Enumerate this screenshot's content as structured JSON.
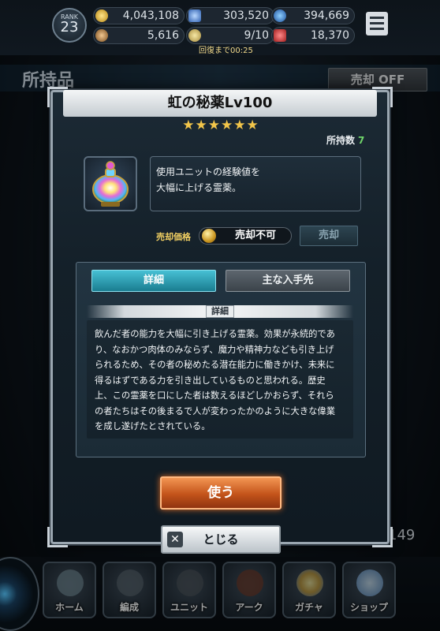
{
  "status": {
    "rank_label": "RANK",
    "rank_value": "23",
    "resources": [
      {
        "icon": "gold-coin-icon",
        "value": "4,043,108"
      },
      {
        "icon": "blue-gem-icon",
        "value": "303,520"
      },
      {
        "icon": "blue-orb-icon",
        "value": "394,669"
      },
      {
        "icon": "bronze-medal-icon",
        "value": "5,616"
      },
      {
        "icon": "stamina-icon",
        "value": "9/10"
      },
      {
        "icon": "red-crystal-icon",
        "value": "18,370"
      }
    ],
    "recover_text": "回復まで00:25"
  },
  "background_page": {
    "title": "所持品",
    "sell_toggle_label": "売却 OFF",
    "partial_count": "149"
  },
  "modal": {
    "title": "虹の秘薬Lv100",
    "stars": "★★★★★★",
    "owned_label": "所持数",
    "owned_value": "7",
    "item_icon": "rainbow-potion-icon",
    "short_description": "使用ユニットの経験値を\n大幅に上げる霊薬。",
    "price_label": "売却価格",
    "price_value": "売却不可",
    "sell_button_label": "売却",
    "tabs": [
      {
        "label": "詳細",
        "active": true
      },
      {
        "label": "主な入手先",
        "active": false
      }
    ],
    "section_caption": "詳細",
    "long_description": "飲んだ者の能力を大幅に引き上げる霊薬。効果が永続的であり、なおかつ肉体のみならず、魔力や精神力なども引き上げられるため、その者の秘めたる潜在能力に働きかけ、未来に得るはずである力を引き出しているものと思われる。歴史上、この霊薬を口にした者は数えるほどしかおらず、それらの者たちはその後まるで人が変わったかのように大きな偉業を成し遂げたとされている。",
    "use_button_label": "使う",
    "close_button_label": "とじる"
  },
  "nav": [
    {
      "label": "ホーム",
      "icon": "home-icon"
    },
    {
      "label": "編成",
      "icon": "party-icon"
    },
    {
      "label": "ユニット",
      "icon": "unit-icon"
    },
    {
      "label": "アーク",
      "icon": "ark-icon"
    },
    {
      "label": "ガチャ",
      "icon": "gacha-icon"
    },
    {
      "label": "ショップ",
      "icon": "shop-icon"
    }
  ],
  "colors": {
    "accent_gold": "#f3c64a",
    "owned_green": "#70d66a",
    "tab_active": "#2aa4bb",
    "use_button": "#d9642a"
  }
}
